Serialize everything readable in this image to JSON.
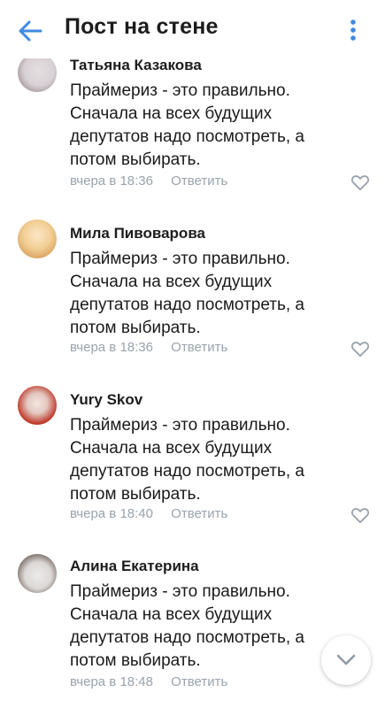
{
  "header": {
    "title": "Пост на стене",
    "back_icon": "arrow-left-icon",
    "more_icon": "vertical-dots-icon",
    "accent": "#3f8ae0"
  },
  "comments": [
    {
      "author": "Татьяна Казакова",
      "text": "Праймериз - это правильно. Сначала на всех будущих депутатов надо посмотреть, а потом выбирать.",
      "time": "вчера в 18:36",
      "reply": "Ответить"
    },
    {
      "author": "Мила Пивоварова",
      "text": "Праймериз - это правильно. Сначала на всех будущих депутатов надо посмотреть, а потом выбирать.",
      "time": "вчера в 18:36",
      "reply": "Ответить"
    },
    {
      "author": "Yury Skov",
      "text": "Праймериз - это правильно. Сначала на всех будущих депутатов надо посмотреть, а потом выбирать.",
      "time": "вчера в 18:40",
      "reply": "Ответить"
    },
    {
      "author": "Алина Екатерина",
      "text": "Праймериз - это правильно. Сначала на всех будущих депутатов надо посмотреть, а потом выбирать.",
      "time": "вчера в 18:48",
      "reply": "Ответить"
    }
  ],
  "scroll_down_icon": "chevron-down-icon",
  "like_icon": "heart-outline-icon",
  "meta_color": "#9aa3ad"
}
